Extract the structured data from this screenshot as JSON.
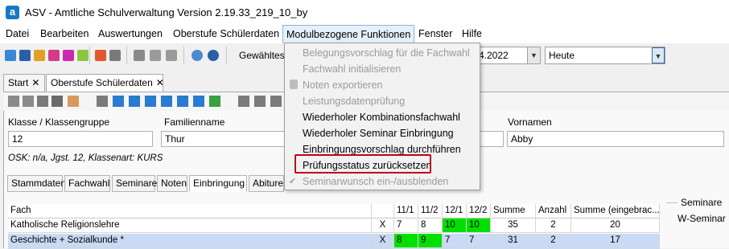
{
  "app": {
    "icon_letter": "a",
    "title": "ASV - Amtliche Schulverwaltung Version 2.19.33_219_10_by"
  },
  "menubar": {
    "items": [
      "Datei",
      "Bearbeiten",
      "Auswertungen",
      "Oberstufe Schülerdaten",
      "Modulbezogene Funktionen",
      "Fenster",
      "Hilfe"
    ]
  },
  "toolbar": {
    "selected_label": "Gewähltes",
    "date_value": "4.2022",
    "period_value": "Heute"
  },
  "tabs": [
    {
      "label": "Start"
    },
    {
      "label": "Oberstufe Schülerdaten"
    }
  ],
  "tab_close_symbol": "✕",
  "form": {
    "klasse_label": "Klasse / Klassengruppe",
    "klasse_value": "12",
    "familienname_label": "Familienname",
    "familienname_value": "Thur",
    "vornamen_label": "Vornamen",
    "vornamen_value": "Abby",
    "osk_text": "OSK: n/a, Jgst. 12, Klassenart: KURS"
  },
  "subtabs": [
    "Stammdaten",
    "Fachwahl",
    "Seminare",
    "Noten",
    "Einbringung",
    "Abiture"
  ],
  "grid": {
    "columns": [
      "Fach",
      "",
      "11/1",
      "11/2",
      "12/1",
      "12/2",
      "Summe",
      "Anzahl",
      "Summe (eingebrac..."
    ],
    "rows": [
      {
        "fach": "Katholische Religionslehre",
        "mark": "X",
        "s111": "7",
        "s112": "8",
        "s121": "10",
        "s122": "10",
        "summe": "35",
        "anzahl": "2",
        "summe_eing": "20"
      },
      {
        "fach": "Geschichte + Sozialkunde *",
        "mark": "X",
        "s111": "8",
        "s112": "9",
        "s121": "7",
        "s122": "7",
        "summe": "31",
        "anzahl": "2",
        "summe_eing": "17"
      }
    ]
  },
  "seminare": {
    "title": "Seminare",
    "w_seminar": "W-Seminar"
  },
  "dropdown": {
    "items": [
      {
        "label": "Belegungsvorschlag für die Fachwahl",
        "enabled": false
      },
      {
        "label": "Fachwahl initialisieren",
        "enabled": false
      },
      {
        "label": "Noten exportieren",
        "enabled": false
      },
      {
        "label": "Leistungsdatenprüfung",
        "enabled": false
      },
      {
        "label": "Wiederholer Kombinationsfachwahl",
        "enabled": true
      },
      {
        "label": "Wiederholer Seminar Einbringung",
        "enabled": true
      },
      {
        "label": "Einbringungsvorschlag durchführen",
        "enabled": true
      },
      {
        "label": "Prüfungsstatus zurücksetzen",
        "enabled": true
      },
      {
        "label": "Seminarwunsch ein-/ausblenden",
        "enabled": false
      }
    ],
    "check_symbol": "✔"
  },
  "colors": {
    "highlight_box": "#c0001a",
    "green_cell": "#00e000",
    "selected_row": "#c8daf4"
  }
}
